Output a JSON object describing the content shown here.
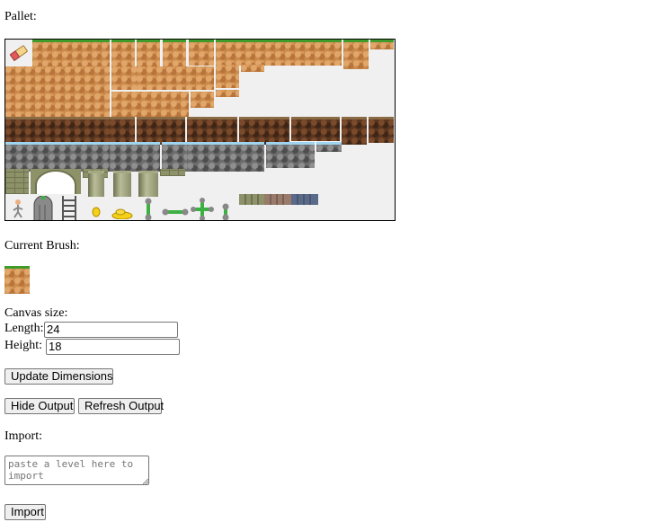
{
  "pallet": {
    "label": "Pallet:"
  },
  "brush": {
    "label": "Current Brush:"
  },
  "canvas": {
    "label": "Canvas size:",
    "length_label": "Length:",
    "length_value": "24",
    "height_label": "Height:",
    "height_value": "18",
    "update_button": "Update Dimensions"
  },
  "output": {
    "hide_button": "Hide Output",
    "refresh_button": "Refresh Output"
  },
  "import": {
    "label": "Import:",
    "placeholder": "paste a level here to import",
    "button": "Import"
  }
}
